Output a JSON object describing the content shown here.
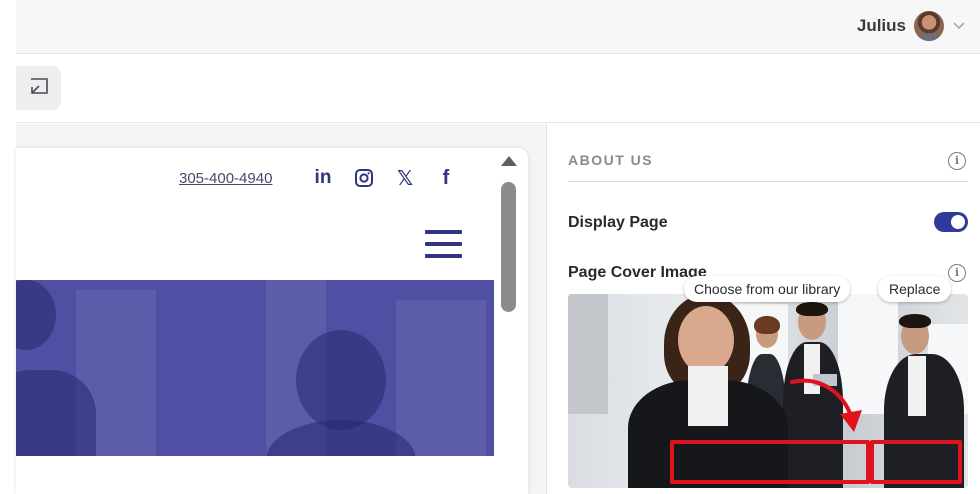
{
  "header": {
    "user_name": "Julius",
    "user_menu_icon": "chevron-down-icon"
  },
  "toolbar": {
    "collapse_icon": "arrow-to-corner-icon"
  },
  "preview": {
    "phone": "305-400-4940",
    "socials": [
      {
        "label": "in",
        "icon": "linkedin-icon"
      },
      {
        "label": "",
        "icon": "instagram-icon"
      },
      {
        "label": "𝕏",
        "icon": "x-icon"
      },
      {
        "label": "f",
        "icon": "facebook-icon"
      }
    ],
    "menu_icon": "hamburger-menu-icon"
  },
  "panel": {
    "section_title": "ABOUT US",
    "display_page_label": "Display Page",
    "display_page_enabled": true,
    "cover_image_label": "Page Cover Image",
    "choose_library_label": "Choose from our library",
    "replace_label": "Replace"
  },
  "colors": {
    "accent": "#2f3a9a",
    "brand_navy": "#2f3580",
    "hero_overlay": "#4f4fa3",
    "highlight": "#e0121e"
  }
}
